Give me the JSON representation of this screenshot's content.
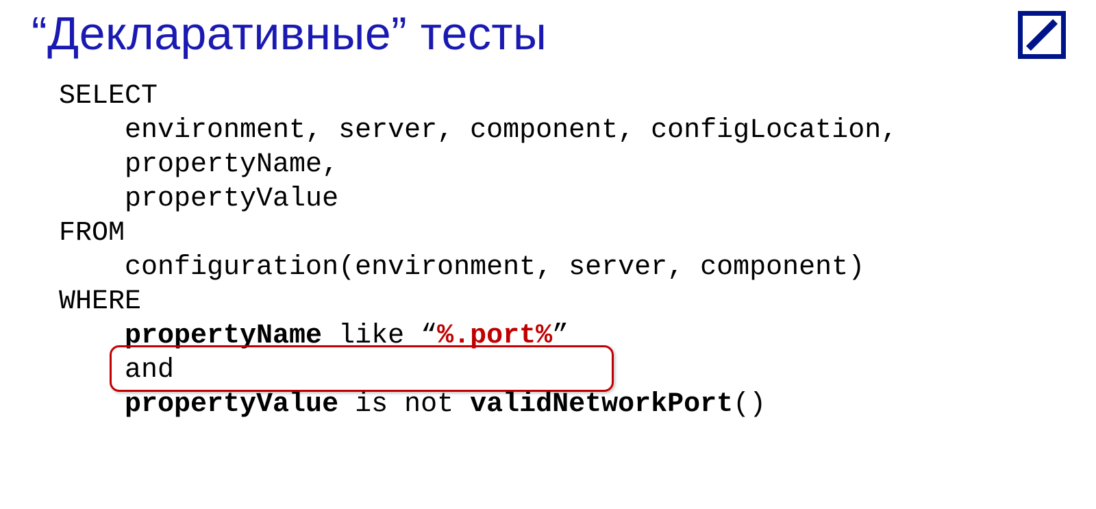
{
  "title": "“Декларативные” тесты",
  "code": {
    "l1": "SELECT",
    "l2": "    environment, server, component, configLocation,",
    "l3": "    propertyName,",
    "l4": "    propertyValue",
    "l5": "FROM",
    "l6": "    configuration(environment, server, component)",
    "l7": "WHERE",
    "l8a": "    ",
    "l8_pname": "propertyName",
    "l8_like": " like “",
    "l8_port": "%.port%",
    "l8_end": "”",
    "l9": "    and",
    "l10a": "    ",
    "l10_pv": "propertyValue",
    "l10_isnot": " is not ",
    "l10_fn": "validNetworkPort",
    "l10_par": "()"
  }
}
